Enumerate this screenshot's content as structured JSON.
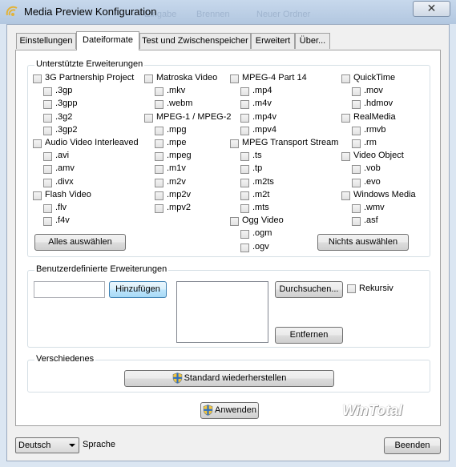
{
  "window": {
    "title": "Media Preview Konfiguration",
    "close_glyph": "✕",
    "background_menu": [
      "Eingabe",
      "Brennen",
      "Neuer Ordner"
    ]
  },
  "tabs": [
    {
      "label": "Einstellungen",
      "active": false
    },
    {
      "label": "Dateiformate",
      "active": true
    },
    {
      "label": "Test und Zwischenspeicher",
      "active": false
    },
    {
      "label": "Erweitert",
      "active": false
    },
    {
      "label": "Über...",
      "active": false
    }
  ],
  "supported": {
    "title": "Unterstützte Erweiterungen",
    "columns": [
      [
        {
          "name": "3G Partnership Project",
          "exts": [
            ".3gp",
            ".3gpp",
            ".3g2",
            ".3gp2"
          ]
        },
        {
          "name": "Audio Video Interleaved",
          "exts": [
            ".avi",
            ".amv",
            ".divx"
          ]
        },
        {
          "name": "Flash Video",
          "exts": [
            ".flv",
            ".f4v"
          ]
        }
      ],
      [
        {
          "name": "Matroska Video",
          "exts": [
            ".mkv",
            ".webm"
          ]
        },
        {
          "name": "MPEG-1 / MPEG-2",
          "exts": [
            ".mpg",
            ".mpe",
            ".mpeg",
            ".m1v",
            ".m2v",
            ".mp2v",
            ".mpv2"
          ]
        }
      ],
      [
        {
          "name": "MPEG-4 Part 14",
          "exts": [
            ".mp4",
            ".m4v",
            ".mp4v",
            ".mpv4"
          ]
        },
        {
          "name": "MPEG Transport Stream",
          "exts": [
            ".ts",
            ".tp",
            ".m2ts",
            ".m2t",
            ".mts"
          ]
        },
        {
          "name": "Ogg Video",
          "exts": [
            ".ogm",
            ".ogv"
          ]
        }
      ],
      [
        {
          "name": "QuickTime",
          "exts": [
            ".mov",
            ".hdmov"
          ]
        },
        {
          "name": "RealMedia",
          "exts": [
            ".rmvb",
            ".rm"
          ]
        },
        {
          "name": "Video Object",
          "exts": [
            ".vob",
            ".evo"
          ]
        },
        {
          "name": "Windows Media",
          "exts": [
            ".wmv",
            ".asf"
          ]
        }
      ]
    ],
    "select_all": "Alles auswählen",
    "select_none": "Nichts auswählen"
  },
  "custom": {
    "title": "Benutzerdefinierte Erweiterungen",
    "input_value": "",
    "add": "Hinzufügen",
    "browse": "Durchsuchen...",
    "recursive": "Rekursiv",
    "remove": "Entfernen"
  },
  "misc": {
    "title": "Verschiedenes",
    "restore": "Standard wiederherstellen"
  },
  "apply": "Anwenden",
  "watermark": "WinTotal",
  "footer": {
    "language_value": "Deutsch",
    "language_label": "Sprache",
    "exit": "Beenden"
  },
  "colors": {
    "titlebar": "#b9cce4",
    "focus_button": "#bee6fd"
  }
}
